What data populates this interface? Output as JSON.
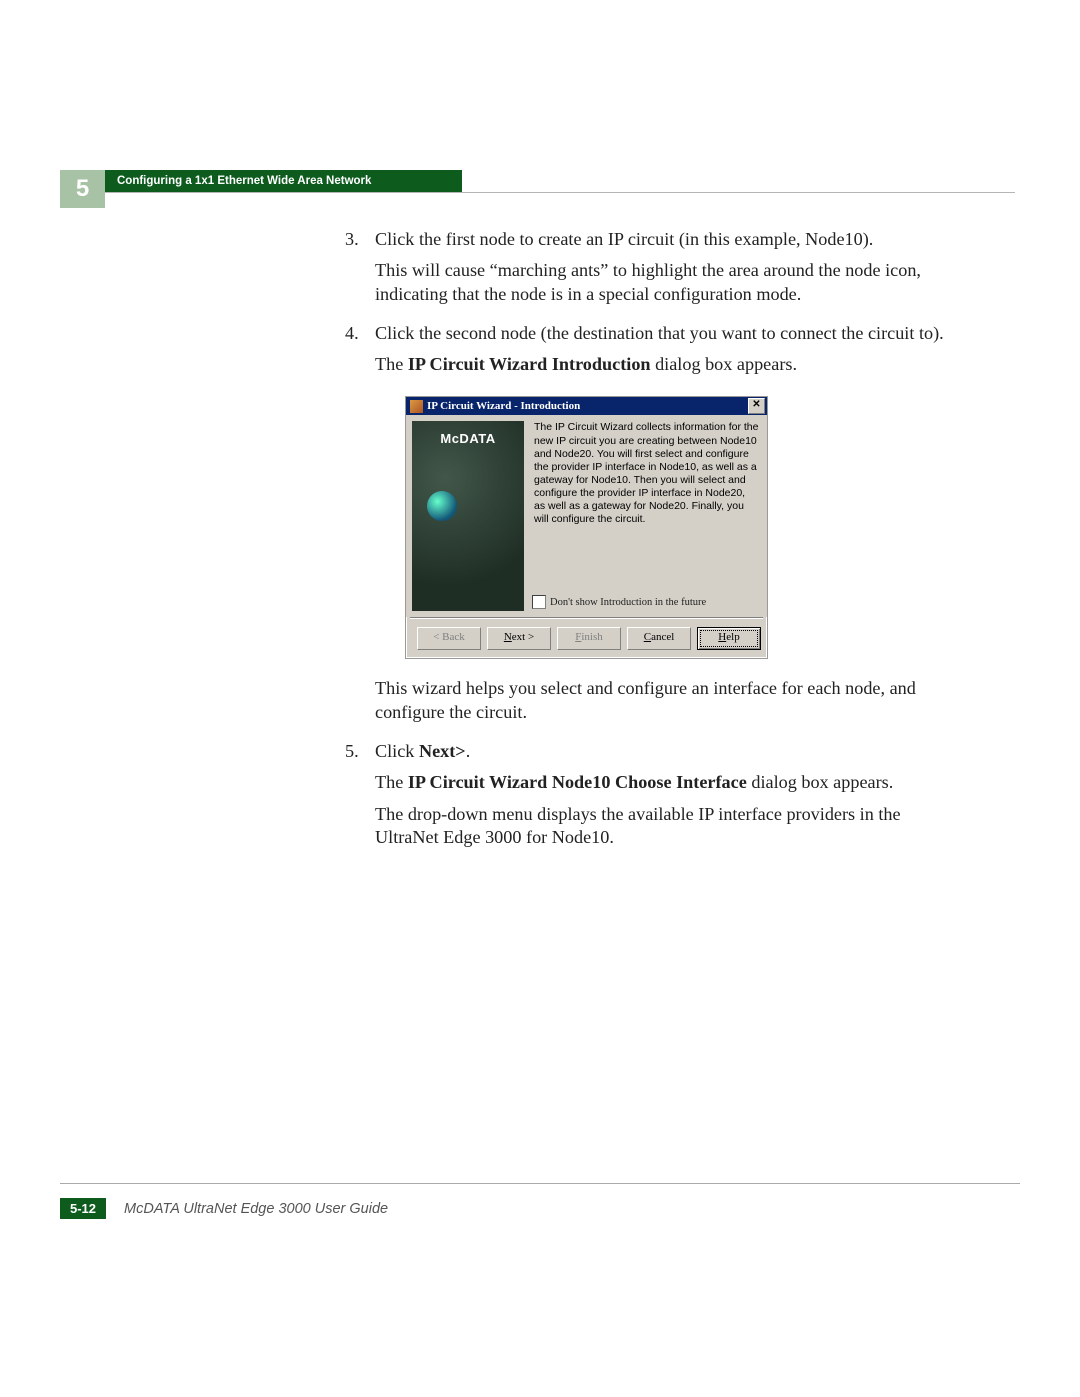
{
  "chapter_number": "5",
  "header_title": "Configuring a 1x1 Ethernet Wide Area Network",
  "steps": {
    "s3": {
      "num": "3.",
      "p1": "Click the first node to create an IP circuit (in this example, Node10).",
      "p2": "This will cause “marching ants” to highlight the area around the node icon, indicating that the node is in a special configuration mode."
    },
    "s4": {
      "num": "4.",
      "p1": "Click the second node (the destination that you want to connect the circuit to).",
      "p2_pre": "The ",
      "p2_bold": "IP Circuit Wizard Introduction",
      "p2_post": " dialog box appears."
    },
    "post_dialog_p": "This wizard helps you select and configure an interface for each node, and configure the circuit.",
    "s5": {
      "num": "5.",
      "p1_pre": "Click ",
      "p1_bold": "Next>",
      "p1_post": ".",
      "p2_pre": "The ",
      "p2_bold": "IP Circuit Wizard Node10 Choose Interface",
      "p2_post": " dialog box appears.",
      "p3": "The drop-down menu displays the available IP interface providers in the UltraNet Edge 3000 for Node10."
    }
  },
  "dialog": {
    "title": "IP Circuit Wizard - Introduction",
    "close_glyph": "✕",
    "logo_text": "McDATA",
    "description": "The IP Circuit Wizard collects information for the new IP circuit you are creating between Node10 and Node20. You will first select and configure the provider IP interface in Node10, as well as a gateway for Node10. Then you will select and configure the provider IP interface in Node20, as well as a gateway for Node20. Finally, you will configure the circuit.",
    "checkbox_label": "Don't show Introduction in the future",
    "buttons": {
      "back": "< Back",
      "next_u": "N",
      "next_rest": "ext >",
      "finish_u": "F",
      "finish_rest": "inish",
      "cancel_u": "C",
      "cancel_rest": "ancel",
      "help_u": "H",
      "help_rest": "elp"
    }
  },
  "footer": {
    "page_num": "5-12",
    "guide": "McDATA UltraNet Edge 3000 User Guide"
  }
}
